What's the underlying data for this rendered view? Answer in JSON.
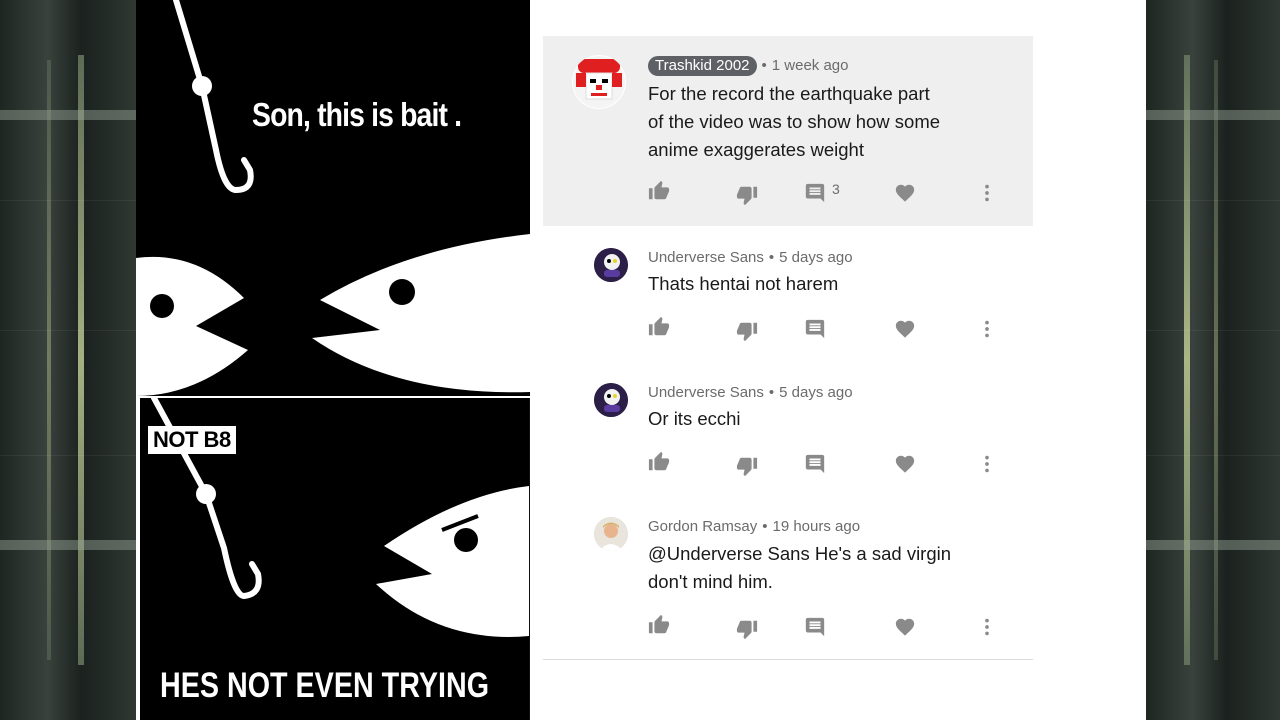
{
  "meme": {
    "top_caption": "Son, this is bait .",
    "label_tag": "NOT B8",
    "bottom_caption": "HES NOT EVEN TRYING"
  },
  "comments": [
    {
      "author": "Trashkid 2002",
      "time": "1 week ago",
      "text_lines": [
        "For the record the earthquake part",
        "of the video was to show how some",
        "anime exaggerates weight"
      ],
      "reply_count": "3",
      "highlighted": true
    },
    {
      "author": "Underverse Sans",
      "time": "5 days ago",
      "text_lines": [
        "Thats hentai not harem"
      ]
    },
    {
      "author": "Underverse Sans",
      "time": "5 days ago",
      "text_lines": [
        "Or its ecchi"
      ]
    },
    {
      "author": "Gordon Ramsay",
      "time": "19 hours ago",
      "text_lines": [
        "@Underverse Sans He's a sad virgin",
        "don't mind him."
      ]
    }
  ],
  "icons": {
    "like": "thumbs-up-icon",
    "dislike": "thumbs-down-icon",
    "reply": "comment-icon",
    "heart": "heart-icon",
    "more": "more-vert-icon"
  },
  "colors": {
    "chip_bg": "#5d6166",
    "highlight_bg": "#efefef",
    "icon_gray": "#8a8a8a"
  }
}
